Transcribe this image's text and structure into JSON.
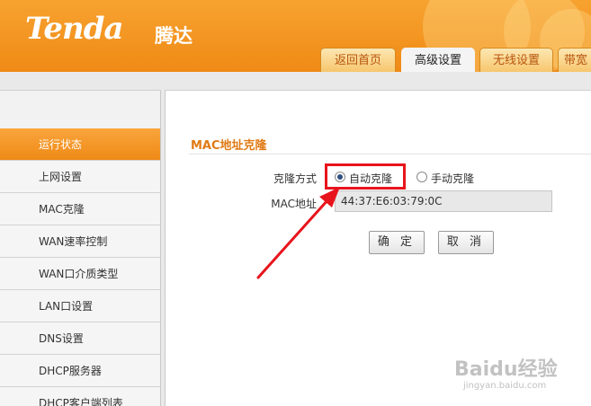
{
  "header": {
    "logo_text": "Tenda",
    "logo_cn": "腾达",
    "tabs": [
      {
        "label": "返回首页",
        "active": false
      },
      {
        "label": "高级设置",
        "active": true
      },
      {
        "label": "无线设置",
        "active": false
      },
      {
        "label": "带宽",
        "active": false
      }
    ]
  },
  "sidebar": {
    "items": [
      {
        "label": "运行状态",
        "active": true
      },
      {
        "label": "上网设置",
        "active": false
      },
      {
        "label": "MAC克隆",
        "active": false
      },
      {
        "label": "WAN速率控制",
        "active": false
      },
      {
        "label": "WAN口介质类型",
        "active": false
      },
      {
        "label": "LAN口设置",
        "active": false
      },
      {
        "label": "DNS设置",
        "active": false
      },
      {
        "label": "DHCP服务器",
        "active": false
      },
      {
        "label": "DHCP客户端列表",
        "active": false
      }
    ]
  },
  "main": {
    "section_title": "MAC地址克隆",
    "clone_mode_label": "克隆方式",
    "options": [
      {
        "label": "自动克隆",
        "checked": true
      },
      {
        "label": "手动克隆",
        "checked": false
      }
    ],
    "mac_label": "MAC地址",
    "mac_value": "44:37:E6:03:79:0C",
    "ok_label": "确 定",
    "cancel_label": "取 消"
  },
  "watermark": {
    "text": "Baidu经验",
    "url": "jingyan.baidu.com"
  },
  "colors": {
    "header_orange": "#f08a15",
    "active_menu": "#ef8a17",
    "title_orange": "#e07a14",
    "annotation_red": "#e8141c"
  }
}
